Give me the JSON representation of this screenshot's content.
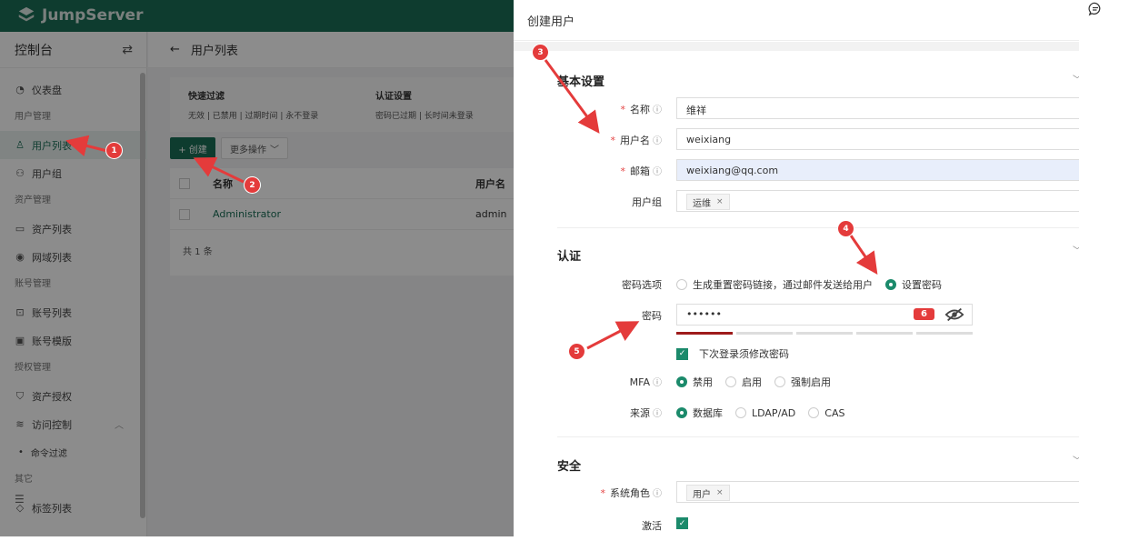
{
  "app": {
    "brand": "JumpServer"
  },
  "sidebar": {
    "title": "控制台",
    "swap_icon": "⇄",
    "groups": {
      "overview": {
        "items": [
          {
            "label": "仪表盘"
          }
        ]
      },
      "user_mgmt": {
        "label": "用户管理",
        "items": [
          {
            "label": "用户列表"
          },
          {
            "label": "用户组"
          }
        ]
      },
      "asset_mgmt": {
        "label": "资产管理",
        "items": [
          {
            "label": "资产列表"
          },
          {
            "label": "网域列表"
          }
        ]
      },
      "account_mgmt": {
        "label": "账号管理",
        "items": [
          {
            "label": "账号列表"
          },
          {
            "label": "账号模版"
          }
        ]
      },
      "perm_mgmt": {
        "label": "授权管理",
        "items": [
          {
            "label": "资产授权"
          },
          {
            "label": "访问控制"
          }
        ],
        "sub": [
          {
            "label": "命令过滤"
          }
        ]
      },
      "other": {
        "label": "其它",
        "items": [
          {
            "label": "标签列表"
          }
        ]
      }
    },
    "bottom_icon": "☰"
  },
  "main": {
    "title": "用户列表",
    "quick_filter": {
      "title": "快速过滤",
      "options": "无效 | 已禁用 | 过期时间 | 永不登录"
    },
    "auth_filter": {
      "title": "认证设置",
      "options": "密码已过期 | 长时间未登录"
    },
    "create_label": "+ 创建",
    "more_label": "更多操作",
    "table": {
      "headers": {
        "name": "名称",
        "username": "用户名"
      },
      "rows": [
        {
          "name": "Administrator",
          "username": "admin"
        }
      ]
    },
    "footer": "共 1 条"
  },
  "drawer": {
    "title": "创建用户",
    "basic": {
      "title": "基本设置",
      "name_label": "名称",
      "name_value": "维祥",
      "username_label": "用户名",
      "username_value": "weixiang",
      "email_label": "邮箱",
      "email_value": "weixiang@qq.com",
      "group_label": "用户组",
      "group_tag": "运维"
    },
    "auth": {
      "title": "认证",
      "pwd_option_label": "密码选项",
      "pwd_option_a": "生成重置密码链接，通过邮件发送给用户",
      "pwd_option_b": "设置密码",
      "pwd_label": "密码",
      "pwd_value": "••••••",
      "must_change_label": "下次登录须修改密码",
      "mfa_label": "MFA",
      "mfa_options": [
        "禁用",
        "启用",
        "强制启用"
      ],
      "source_label": "来源",
      "source_options": [
        "数据库",
        "LDAP/AD",
        "CAS"
      ]
    },
    "security": {
      "title": "安全",
      "role_label": "系统角色",
      "role_tag": "用户",
      "active_label": "激活"
    }
  },
  "annotations": {
    "b1": "1",
    "b2": "2",
    "b3": "3",
    "b4": "4",
    "b5": "5",
    "b6": "6"
  },
  "colors": {
    "brand_green": "#1b6d56",
    "accent_radio": "#1b8a6b",
    "annotation_red": "#e43b3b"
  }
}
